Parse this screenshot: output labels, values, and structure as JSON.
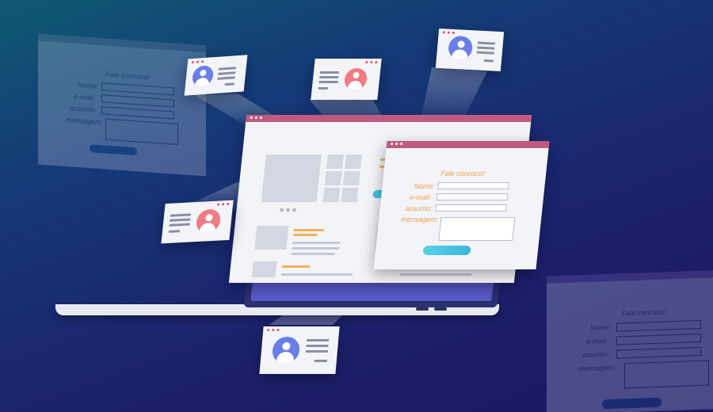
{
  "colors": {
    "accent_cyan": "#3fc3e0",
    "accent_pink": "#c05a82",
    "label_orange": "#f0a050",
    "avatar_blue": "#6a7ee8",
    "avatar_pink": "#f07a86"
  },
  "contact_form": {
    "title": "Fale conosco!",
    "name_label": "Nome:",
    "email_label": "e-mail:",
    "subject_label": "assunto:",
    "message_label": "mensagem:"
  },
  "ghost_form_left": {
    "title": "Fale conosco!",
    "name_label": "Nome:",
    "email_label": "e-mail:",
    "subject_label": "assunto:",
    "message_label": "mensagem:"
  },
  "ghost_form_right": {
    "title": "Fale conosco!",
    "name_label": "Nome:",
    "email_label": "e-mail:",
    "subject_label": "assunto:",
    "message_label": "mensagem:"
  },
  "icons": {
    "profile_card": "user-avatar-icon",
    "window_controls": "window-dots-icon"
  }
}
